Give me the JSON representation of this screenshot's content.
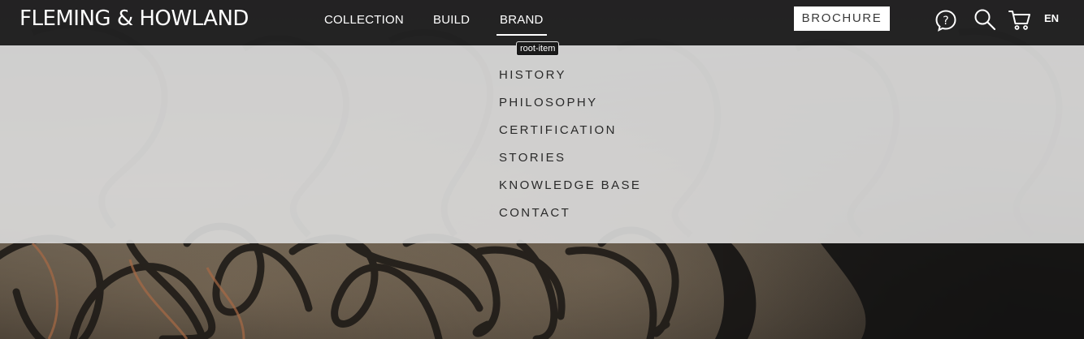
{
  "header": {
    "logo": "FLEMING & HOWLAND",
    "nav": [
      "COLLECTION",
      "BUILD",
      "BRAND"
    ],
    "active_nav": "BRAND",
    "brochure": "BROCHURE",
    "language": "EN",
    "icons": [
      "help-icon",
      "search-icon",
      "cart-icon"
    ]
  },
  "tooltip": "root-item",
  "dropdown": {
    "items": [
      "HISTORY",
      "PHILOSOPHY",
      "CERTIFICATION",
      "STORIES",
      "KNOWLEDGE BASE",
      "CONTACT"
    ]
  },
  "colors": {
    "topbar": "#1e1e20",
    "dropdown": "#dcdcdc",
    "text_dark": "#2a2a2a"
  }
}
